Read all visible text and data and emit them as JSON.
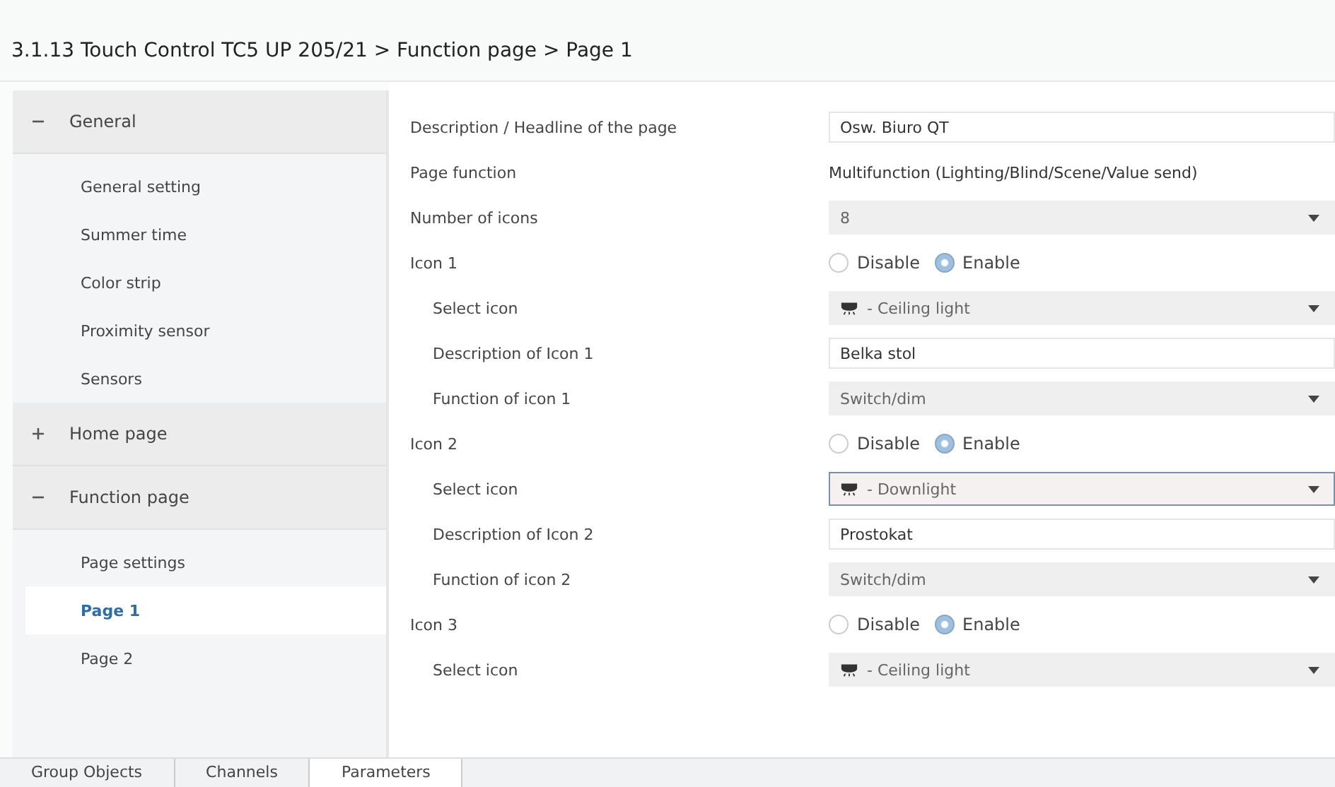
{
  "header": {
    "title": "3.1.13 Touch Control TC5 UP 205/21 > Function page > Page 1"
  },
  "sidebar": {
    "groups": [
      {
        "label": "General",
        "expanded": true,
        "children": [
          {
            "label": "General setting",
            "selected": false
          },
          {
            "label": "Summer time",
            "selected": false
          },
          {
            "label": "Color strip",
            "selected": false
          },
          {
            "label": "Proximity sensor",
            "selected": false
          },
          {
            "label": "Sensors",
            "selected": false
          }
        ]
      },
      {
        "label": "Home page",
        "expanded": false
      },
      {
        "label": "Function page",
        "expanded": true,
        "children": [
          {
            "label": "Page settings",
            "selected": false
          },
          {
            "label": "Page 1",
            "selected": true
          },
          {
            "label": "Page 2",
            "selected": false
          }
        ]
      }
    ]
  },
  "parameters": [
    {
      "kind": "text",
      "label": "Description / Headline of the page",
      "indented": false,
      "value": "Osw. Biuro QT"
    },
    {
      "kind": "static",
      "label": "Page function",
      "indented": false,
      "value": "Multifunction (Lighting/Blind/Scene/Value send)"
    },
    {
      "kind": "dropdown",
      "label": "Number of  icons",
      "indented": false,
      "value": "8",
      "icon": false,
      "focused": false
    },
    {
      "kind": "radio",
      "label": "Icon 1",
      "indented": false,
      "options": [
        {
          "label": "Disable",
          "selected": false
        },
        {
          "label": "Enable",
          "selected": true
        }
      ]
    },
    {
      "kind": "dropdown",
      "label": "Select icon",
      "indented": true,
      "value": "- Ceiling light",
      "icon": true,
      "focused": false
    },
    {
      "kind": "text",
      "label": "Description of Icon 1",
      "indented": true,
      "value": "Belka stol"
    },
    {
      "kind": "dropdown",
      "label": "Function of icon 1",
      "indented": true,
      "value": "Switch/dim",
      "icon": false,
      "focused": false
    },
    {
      "kind": "radio",
      "label": "Icon 2",
      "indented": false,
      "options": [
        {
          "label": "Disable",
          "selected": false
        },
        {
          "label": "Enable",
          "selected": true
        }
      ]
    },
    {
      "kind": "dropdown",
      "label": "Select icon",
      "indented": true,
      "value": "- Downlight",
      "icon": true,
      "focused": true
    },
    {
      "kind": "text",
      "label": "Description of Icon 2",
      "indented": true,
      "value": "Prostokat"
    },
    {
      "kind": "dropdown",
      "label": "Function of icon 2",
      "indented": true,
      "value": "Switch/dim",
      "icon": false,
      "focused": false
    },
    {
      "kind": "radio",
      "label": "Icon 3",
      "indented": false,
      "options": [
        {
          "label": "Disable",
          "selected": false
        },
        {
          "label": "Enable",
          "selected": true
        }
      ]
    },
    {
      "kind": "dropdown",
      "label": "Select icon",
      "indented": true,
      "value": "- Ceiling light",
      "icon": true,
      "focused": false
    }
  ],
  "tabs": [
    {
      "label": "Group Objects",
      "selected": false
    },
    {
      "label": "Channels",
      "selected": false
    },
    {
      "label": "Parameters",
      "selected": true
    }
  ]
}
